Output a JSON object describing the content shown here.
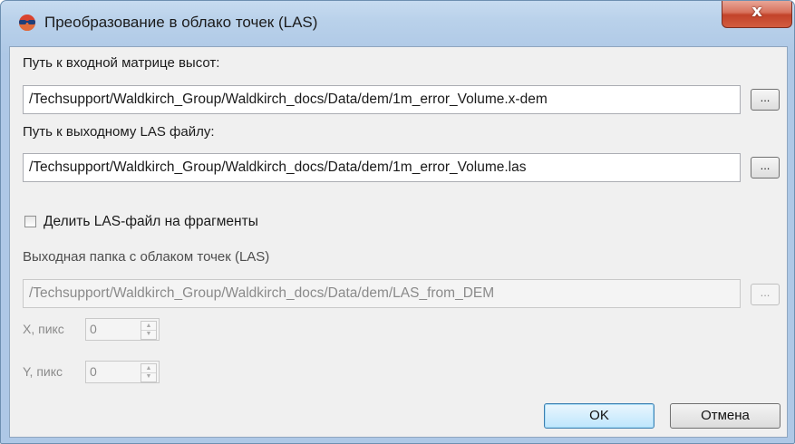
{
  "window": {
    "title": "Преобразование в облако точек (LAS)",
    "close_label": "x"
  },
  "input_dem": {
    "label": "Путь к входной матрице высот:",
    "value": "/Techsupport/Waldkirch_Group/Waldkirch_docs/Data/dem/1m_error_Volume.x-dem",
    "browse_label": "..."
  },
  "output_las": {
    "label": "Путь к выходному LAS файлу:",
    "value": "/Techsupport/Waldkirch_Group/Waldkirch_docs/Data/dem/1m_error_Volume.las",
    "browse_label": "..."
  },
  "split": {
    "label": "Делить LAS-файл на фрагменты",
    "checked": false
  },
  "output_folder": {
    "label": "Выходная папка с облаком точек (LAS)",
    "value": "/Techsupport/Waldkirch_Group/Waldkirch_docs/Data/dem/LAS_from_DEM",
    "browse_label": "..."
  },
  "x_pix": {
    "label": "X, пикс",
    "value": "0"
  },
  "y_pix": {
    "label": "Y, пикс",
    "value": "0"
  },
  "buttons": {
    "ok": "OK",
    "cancel": "Отмена"
  },
  "colors": {
    "title_bar": "#b9d1ea",
    "close_button": "#c2432a",
    "client_background": "#f0f0f0",
    "default_button": "#bee6fd"
  }
}
